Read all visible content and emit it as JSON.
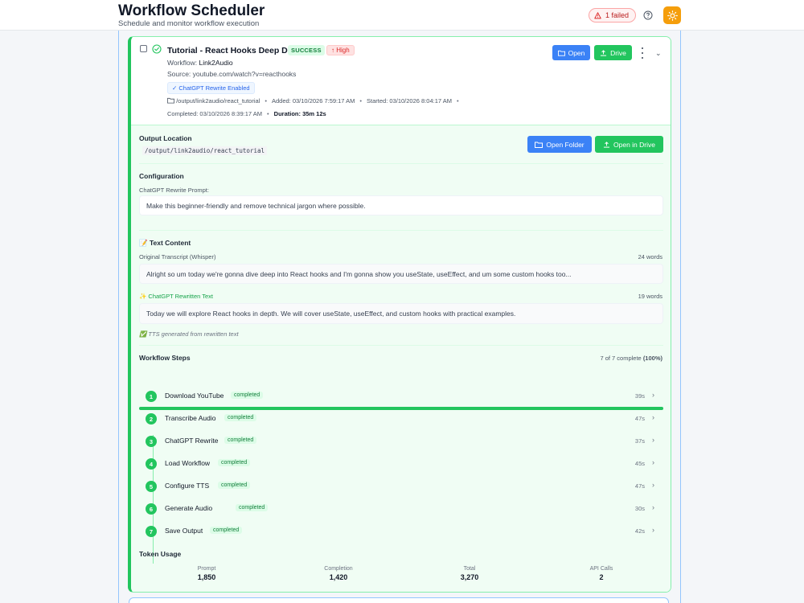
{
  "header": {
    "title": "Workflow Scheduler",
    "subtitle": "Schedule and monitor workflow execution",
    "failed_badge": "1 failed",
    "help_icon": "help-circle-icon",
    "theme_icon": "sun-icon"
  },
  "job": {
    "title": "Tutorial - React Hooks Deep Dive",
    "status": "SUCCESS",
    "priority": "High",
    "workflow_label": "Workflow:",
    "workflow_value": "Link2Audio",
    "source_label": "Source:",
    "source_value": "youtube.com/watch?v=reacthooks",
    "rewrite_chip": "✓ ChatGPT Rewrite Enabled",
    "path": "/output/link2audio/react_tutorial",
    "added": "Added: 03/10/2026 7:59:17 AM",
    "started": "Started: 03/10/2026 8:04:17 AM",
    "completed": "Completed: 03/10/2026 8:39:17 AM",
    "duration": "Duration: 35m 12s",
    "open_label": "Open",
    "drive_label": "Drive"
  },
  "output": {
    "title": "Output Location",
    "path": "/output/link2audio/react_tutorial",
    "open_folder_label": "Open Folder",
    "open_drive_label": "Open in Drive"
  },
  "configuration": {
    "title": "Configuration",
    "prompt_label": "ChatGPT Rewrite Prompt:",
    "prompt_text": "Make this beginner-friendly and remove technical jargon where possible."
  },
  "text_content": {
    "title": "📝 Text Content",
    "original_label": "Original Transcript (Whisper)",
    "original_count": "24 words",
    "original_text": "Alright so um today we're gonna dive deep into React hooks and I'm gonna show you useState, useEffect, and um some custom hooks too...",
    "rewritten_label": "✨ ChatGPT Rewritten Text",
    "rewritten_count": "19 words",
    "rewritten_text": "Today we will explore React hooks in depth. We will cover useState, useEffect, and custom hooks with practical examples.",
    "tts_note": "✅ TTS generated from rewritten text"
  },
  "steps": {
    "title": "Workflow Steps",
    "summary": "7 of 7 complete",
    "percent_label": "(100%)",
    "progress": 1.0,
    "items": [
      {
        "num": "1",
        "name": "Download YouTube",
        "status": "completed",
        "duration": "39s"
      },
      {
        "num": "2",
        "name": "Transcribe Audio",
        "status": "completed",
        "duration": "47s"
      },
      {
        "num": "3",
        "name": "ChatGPT Rewrite",
        "status": "completed",
        "duration": "37s"
      },
      {
        "num": "4",
        "name": "Load Workflow",
        "status": "completed",
        "duration": "45s"
      },
      {
        "num": "5",
        "name": "Configure TTS",
        "status": "completed",
        "duration": "47s"
      },
      {
        "num": "6",
        "name": "Generate Audio",
        "status": "completed",
        "duration": "30s"
      },
      {
        "num": "7",
        "name": "Save Output",
        "status": "completed",
        "duration": "42s"
      }
    ]
  },
  "tokens": {
    "title": "Token Usage",
    "prompt_label": "Prompt",
    "prompt_value": "1,850",
    "completion_label": "Completion",
    "completion_value": "1,420",
    "total_label": "Total",
    "total_value": "3,270",
    "calls_label": "API Calls",
    "calls_value": "2"
  },
  "colors": {
    "success": "#22c55e",
    "primary": "#3b82f6",
    "danger": "#dc2626",
    "warning": "#f59e0b"
  }
}
